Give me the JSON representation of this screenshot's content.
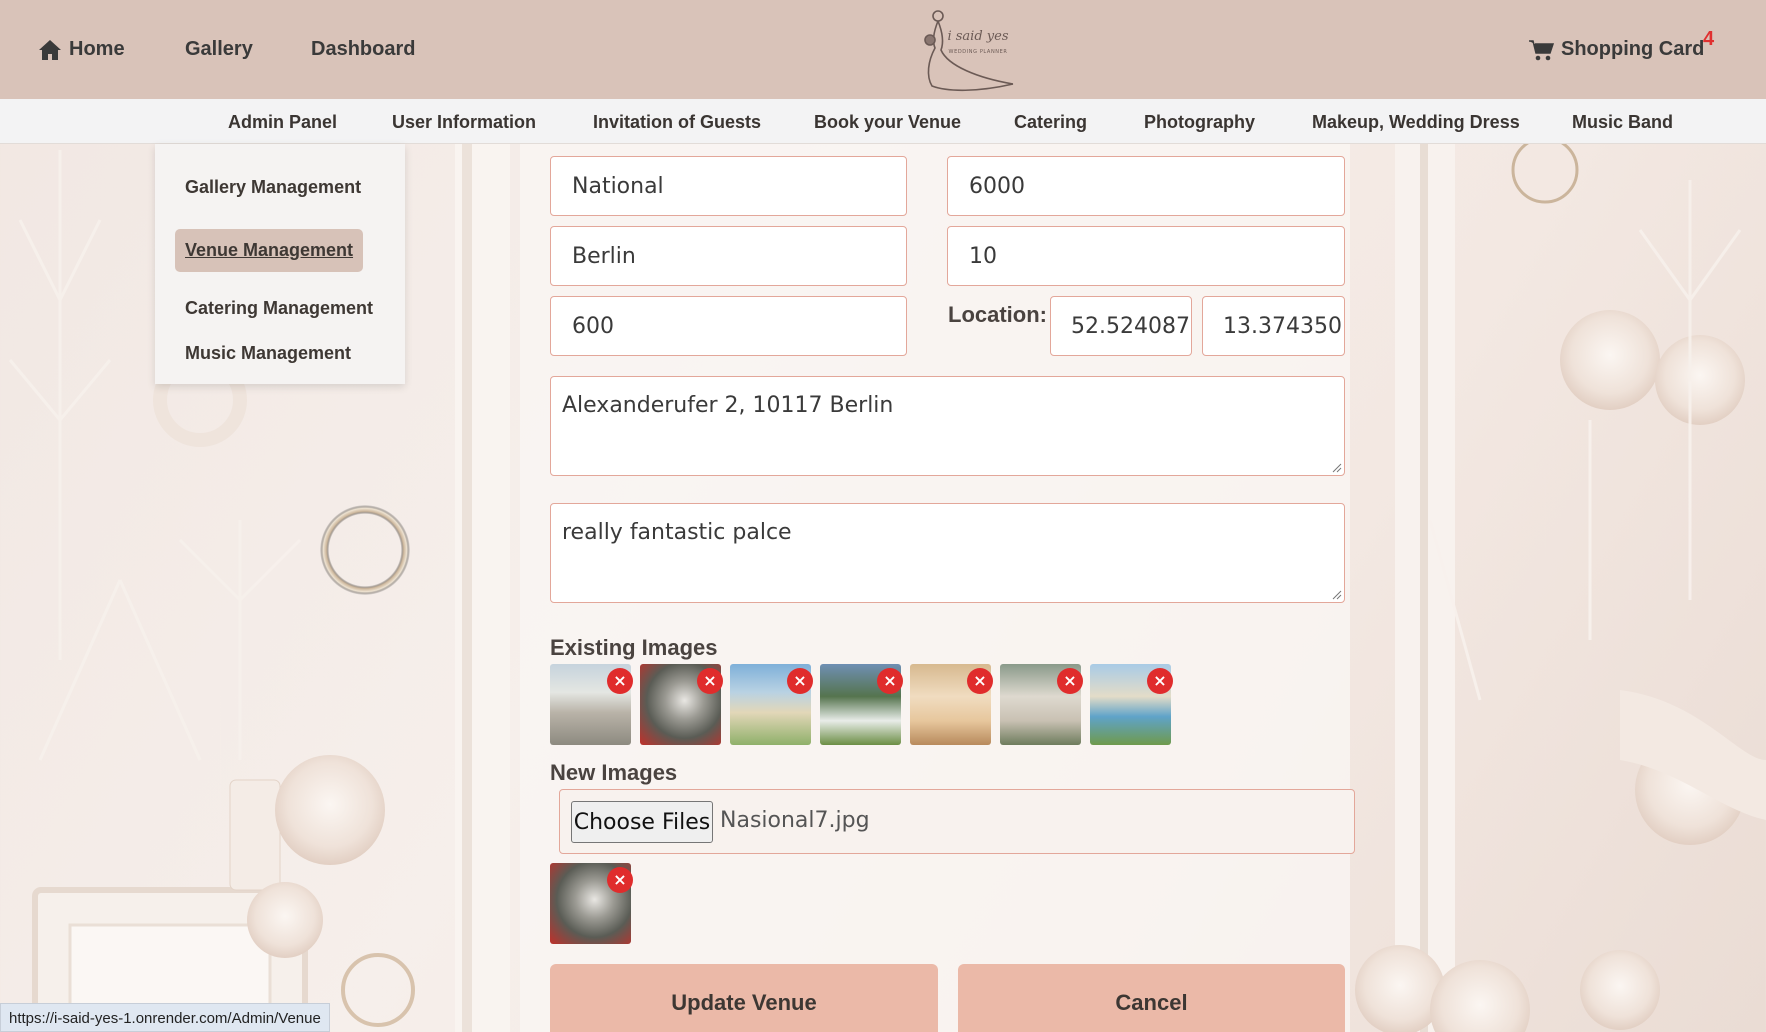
{
  "header": {
    "home_label": "Home",
    "gallery_label": "Gallery",
    "dashboard_label": "Dashboard",
    "logo_alt": "i said yes wedding planner",
    "cart_label": "Shopping Card",
    "cart_count": "4"
  },
  "admin_nav": {
    "items": [
      "Admin Panel",
      "User Information",
      "Invitation of Guests",
      "Book your Venue",
      "Catering",
      "Photography",
      "Makeup, Wedding Dress",
      "Music Band"
    ]
  },
  "dropdown": {
    "items": [
      "Gallery Management",
      "Venue Management",
      "Catering Management",
      "Music Management"
    ],
    "active": "Venue Management"
  },
  "form": {
    "name": "National",
    "price": "6000",
    "city": "Berlin",
    "rating": "10",
    "capacity": "600",
    "location_label": "Location:",
    "latitude": "52.524087",
    "longitude": "13.374350",
    "address": "Alexanderufer 2, 10117 Berlin",
    "description": "really fantastic palce",
    "existing_images_title": "Existing Images",
    "existing_images_count": 7,
    "new_images_title": "New Images",
    "choose_files_label": "Choose Files",
    "selected_file": "Nasional7.jpg",
    "remove_symbol": "×",
    "update_label": "Update Venue",
    "cancel_label": "Cancel"
  },
  "status_bar": {
    "url": "https://i-said-yes-1.onrender.com/Admin/Venue"
  },
  "colors": {
    "header_bg": "#d9c3b9",
    "nav_bg": "#f3f3f4",
    "field_border": "#e3a79a",
    "button_bg": "#ebb9a8",
    "remove_red": "#e02c2c",
    "badge_red": "#e03030"
  }
}
